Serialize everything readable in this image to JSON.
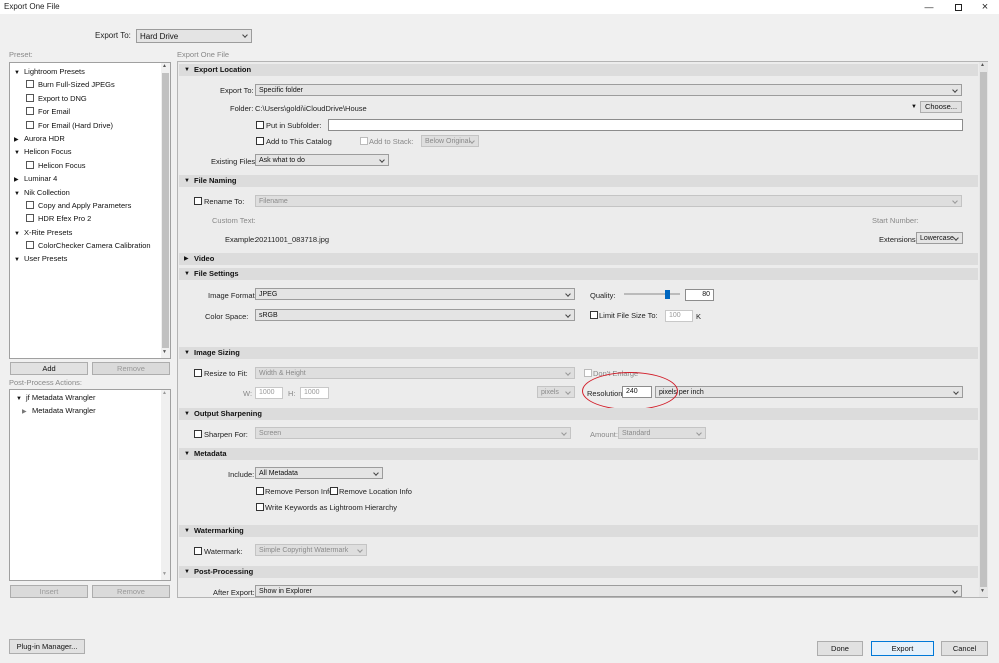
{
  "window": {
    "title": "Export One File"
  },
  "header": {
    "export_to_label": "Export To:",
    "export_to_value": "Hard Drive"
  },
  "presets": {
    "label": "Preset:",
    "items": [
      {
        "text": "Lightroom Presets",
        "kind": "folder",
        "expanded": true
      },
      {
        "text": "Burn Full-Sized JPEGs",
        "kind": "item"
      },
      {
        "text": "Export to DNG",
        "kind": "item"
      },
      {
        "text": "For Email",
        "kind": "item"
      },
      {
        "text": "For Email (Hard Drive)",
        "kind": "item"
      },
      {
        "text": "Aurora HDR",
        "kind": "folder",
        "expanded": false
      },
      {
        "text": "Helicon Focus",
        "kind": "folder",
        "expanded": true
      },
      {
        "text": "Helicon Focus",
        "kind": "item"
      },
      {
        "text": "Luminar 4",
        "kind": "folder",
        "expanded": false
      },
      {
        "text": "Nik Collection",
        "kind": "folder",
        "expanded": true
      },
      {
        "text": "Copy and Apply Parameters",
        "kind": "item"
      },
      {
        "text": "HDR Efex Pro 2",
        "kind": "item"
      },
      {
        "text": "X-Rite Presets",
        "kind": "folder",
        "expanded": true
      },
      {
        "text": "ColorChecker Camera Calibration",
        "kind": "item"
      },
      {
        "text": "User Presets",
        "kind": "folder",
        "expanded": true
      }
    ],
    "add": "Add",
    "remove": "Remove"
  },
  "postprocess": {
    "label": "Post-Process Actions:",
    "items": [
      {
        "text": "jf Metadata Wrangler",
        "kind": "folder"
      },
      {
        "text": "Metadata Wrangler",
        "kind": "child"
      }
    ],
    "insert": "Insert",
    "remove": "Remove"
  },
  "main": {
    "label": "Export One File"
  },
  "sections": {
    "location": "Export Location",
    "naming": "File Naming",
    "video": "Video",
    "settings": "File Settings",
    "sizing": "Image Sizing",
    "sharpening": "Output Sharpening",
    "metadata": "Metadata",
    "watermarking": "Watermarking",
    "postprocessing": "Post-Processing"
  },
  "location": {
    "export_to_label": "Export To:",
    "export_to_value": "Specific folder",
    "folder_label": "Folder:",
    "folder_value": "C:\\Users\\goldi\\iCloudDrive\\House",
    "choose": "Choose...",
    "subfolder_label": "Put in Subfolder:",
    "subfolder_value": "",
    "add_catalog": "Add to This Catalog",
    "add_stack": "Add to Stack:",
    "stack_value": "Below Original",
    "existing_label": "Existing Files:",
    "existing_value": "Ask what to do"
  },
  "naming": {
    "rename_label": "Rename To:",
    "rename_value": "Filename",
    "custom_text": "Custom Text:",
    "start_number": "Start Number:",
    "example_label": "Example:",
    "example_value": "20211001_083718.jpg",
    "extensions_label": "Extensions:",
    "extensions_value": "Lowercase"
  },
  "settings": {
    "format_label": "Image Format:",
    "format_value": "JPEG",
    "quality_label": "Quality:",
    "quality_value": "80",
    "quality_fraction": 0.8,
    "colorspace_label": "Color Space:",
    "colorspace_value": "sRGB",
    "limit_label": "Limit File Size To:",
    "limit_value": "100",
    "limit_unit": "K"
  },
  "sizing": {
    "resize_label": "Resize to Fit:",
    "resize_value": "Width & Height",
    "dont_enlarge": "Don't Enlarge",
    "w_label": "W:",
    "w_value": "1000",
    "h_label": "H:",
    "h_value": "1000",
    "unit_value": "pixels",
    "resolution_label": "Resolution:",
    "resolution_value": "240",
    "resolution_unit": "pixels per inch"
  },
  "sharpening": {
    "sharpen_label": "Sharpen For:",
    "sharpen_value": "Screen",
    "amount_label": "Amount:",
    "amount_value": "Standard"
  },
  "metadata": {
    "include_label": "Include:",
    "include_value": "All Metadata",
    "remove_person": "Remove Person Info",
    "remove_location": "Remove Location Info",
    "write_keywords": "Write Keywords as Lightroom Hierarchy"
  },
  "watermark": {
    "label": "Watermark:",
    "value": "Simple Copyright Watermark"
  },
  "postproc": {
    "after_label": "After Export:",
    "after_value": "Show in Explorer"
  },
  "footer": {
    "plugin": "Plug-in Manager...",
    "done": "Done",
    "export": "Export",
    "cancel": "Cancel"
  },
  "colors": {
    "highlight": "#d21f2b",
    "accent": "#0078d7"
  }
}
